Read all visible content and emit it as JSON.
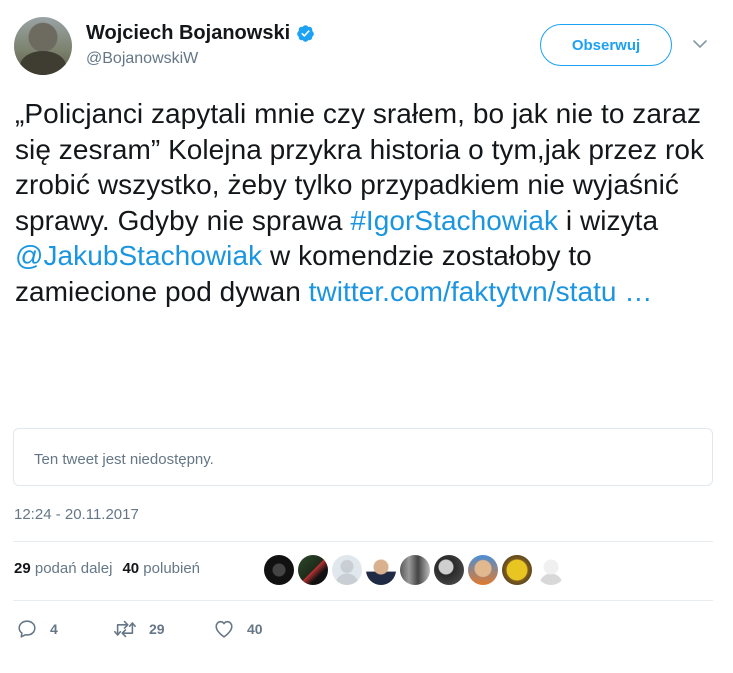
{
  "colors": {
    "accent": "#1da1f2",
    "link": "#1b95e0",
    "muted": "#657786",
    "text": "#14171a",
    "border": "#e1e8ed"
  },
  "author": {
    "display_name": "Wojciech Bojanowski",
    "handle": "@BojanowskiW",
    "verified_icon": "verified-badge-icon"
  },
  "follow_button": {
    "label": "Obserwuj"
  },
  "more_menu": {
    "icon": "chevron-down-icon"
  },
  "tweet": {
    "text_part1": "„Policjanci zapytali mnie czy srałem, bo jak nie to zaraz się zesram” Kolejna przykra historia o tym,jak przez rok zrobić wszystko, żeby tylko przypadkiem nie wyjaśnić sprawy. Gdyby nie sprawa ",
    "hashtag": "#IgorStachowiak",
    "text_part2": " i wizyta ",
    "mention": "@JakubStachowiak",
    "text_part3": " w komendzie zostałoby to zamiecione pod dywan ",
    "link": "twitter.com/faktytvn/statu …"
  },
  "quoted": {
    "text": "Ten tweet jest niedostępny."
  },
  "timestamp": "12:24 - 20.11.2017",
  "stats": {
    "retweets_count": "29",
    "retweets_label": "podań dalej",
    "likes_count": "40",
    "likes_label": "polubień"
  },
  "actions": {
    "reply": {
      "icon": "reply-icon",
      "count": "4"
    },
    "retweet": {
      "icon": "retweet-icon",
      "count": "29"
    },
    "like": {
      "icon": "heart-icon",
      "count": "40"
    }
  }
}
